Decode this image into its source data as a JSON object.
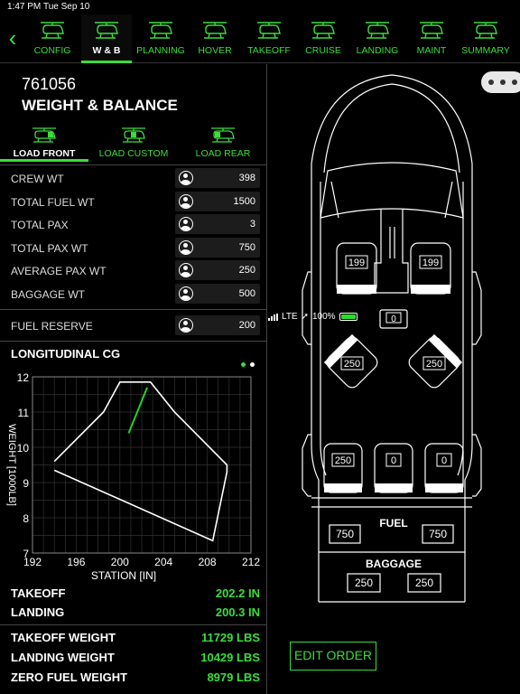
{
  "status": {
    "time": "1:47 PM",
    "date": "Tue Sep 10",
    "network": "LTE",
    "battery": "100%"
  },
  "nav": {
    "back_icon": "chevron-left-icon",
    "tabs": [
      {
        "label": "CONFIG",
        "icon": "helicopter-config-icon",
        "active": false
      },
      {
        "label": "W & B",
        "icon": "helicopter-wb-icon",
        "active": true
      },
      {
        "label": "PLANNING",
        "icon": "helicopter-planning-icon",
        "active": false
      },
      {
        "label": "HOVER",
        "icon": "helicopter-hover-icon",
        "active": false
      },
      {
        "label": "TAKEOFF",
        "icon": "helicopter-takeoff-icon",
        "active": false
      },
      {
        "label": "CRUISE",
        "icon": "helicopter-cruise-icon",
        "active": false
      },
      {
        "label": "LANDING",
        "icon": "helicopter-landing-icon",
        "active": false
      },
      {
        "label": "MAINT",
        "icon": "helicopter-maint-icon",
        "active": false
      },
      {
        "label": "SUMMARY",
        "icon": "helicopter-summary-icon",
        "active": false
      }
    ]
  },
  "aircraft": {
    "id": "761056",
    "title": "WEIGHT & BALANCE"
  },
  "load_tabs": [
    {
      "label": "LOAD FRONT",
      "active": true
    },
    {
      "label": "LOAD CUSTOM",
      "active": false
    },
    {
      "label": "LOAD REAR",
      "active": false
    }
  ],
  "weights": [
    {
      "label": "CREW WT",
      "value": "398"
    },
    {
      "label": "TOTAL FUEL WT",
      "value": "1500"
    },
    {
      "label": "TOTAL PAX",
      "value": "3"
    },
    {
      "label": "TOTAL PAX WT",
      "value": "750"
    },
    {
      "label": "AVERAGE PAX WT",
      "value": "250"
    },
    {
      "label": "BAGGAGE WT",
      "value": "500"
    }
  ],
  "fuel_reserve": {
    "label": "FUEL RESERVE",
    "value": "200"
  },
  "cg": {
    "title": "LONGITUDINAL CG",
    "page_dots": 2,
    "active_dot": 0
  },
  "chart_data": {
    "type": "line",
    "title": "LONGITUDINAL CG",
    "xlabel": "STATION [IN]",
    "ylabel": "WEIGHT [1000LB]",
    "xlim": [
      192,
      212
    ],
    "ylim": [
      7,
      12
    ],
    "xticks": [
      "192",
      "196",
      "200",
      "204",
      "208",
      "212"
    ],
    "yticks": [
      "7",
      "8",
      "9",
      "10",
      "11",
      "12"
    ],
    "grid": true,
    "series": [
      {
        "color": "#ffffff",
        "x": [
          194.0,
          198.5,
          200.0,
          202.8,
          205.0,
          209.8,
          209.8,
          208.5,
          194.0
        ],
        "y": [
          9.6,
          11.0,
          11.85,
          11.85,
          11.0,
          9.5,
          9.3,
          7.35,
          9.35
        ]
      },
      {
        "color": "#28d028",
        "x": [
          200.8,
          202.5
        ],
        "y": [
          10.4,
          11.7
        ]
      }
    ]
  },
  "results": {
    "cg": [
      {
        "label": "TAKEOFF",
        "value": "202.2 IN"
      },
      {
        "label": "LANDING",
        "value": "200.3 IN"
      }
    ],
    "weights": [
      {
        "label": "TAKEOFF WEIGHT",
        "value": "11729 LBS"
      },
      {
        "label": "LANDING WEIGHT",
        "value": "10429 LBS"
      },
      {
        "label": "ZERO FUEL WEIGHT",
        "value": "8979 LBS"
      }
    ]
  },
  "cabin": {
    "seats": {
      "pilot_left": "199",
      "pilot_right": "199",
      "center_jump": "0",
      "mid_left": "250",
      "mid_right": "250",
      "rear_left": "250",
      "rear_center": "0",
      "rear_right": "0"
    },
    "fuel_label": "FUEL",
    "fuel_left": "750",
    "fuel_right": "750",
    "baggage_label": "BAGGAGE",
    "baggage_left": "250",
    "baggage_right": "250"
  },
  "more_icon": "more-horizontal-icon",
  "edit_order_label": "EDIT ORDER",
  "colors": {
    "accent": "#3cdc3c",
    "background": "#000000",
    "field": "#1c1c1c"
  }
}
